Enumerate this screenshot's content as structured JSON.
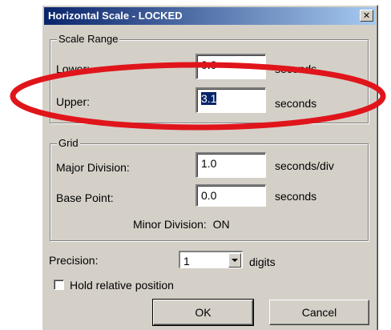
{
  "window": {
    "title": "Horizontal Scale - LOCKED",
    "close_glyph": "✕",
    "close_icon": "close-icon",
    "titlebar_color": "#0a246a"
  },
  "scale_range": {
    "group_label": "Scale Range",
    "lower_label": "Lower:",
    "lower_value": "0.0",
    "lower_unit": "seconds",
    "upper_label": "Upper:",
    "upper_value": "3.1",
    "upper_unit": "seconds"
  },
  "grid": {
    "group_label": "Grid",
    "major_label": "Major Division:",
    "major_value": "1.0",
    "major_unit": "seconds/div",
    "base_label": "Base Point:",
    "base_value": "0.0",
    "base_unit": "seconds",
    "minor_text": "Minor Division:  ON"
  },
  "precision": {
    "label": "Precision:",
    "value": "1",
    "unit": "digits",
    "dropdown_icon": "chevron-down-icon"
  },
  "hold": {
    "label": "Hold relative position",
    "checked": false
  },
  "buttons": {
    "ok": "OK",
    "cancel": "Cancel"
  },
  "annotation": {
    "color": "#e0151b"
  }
}
